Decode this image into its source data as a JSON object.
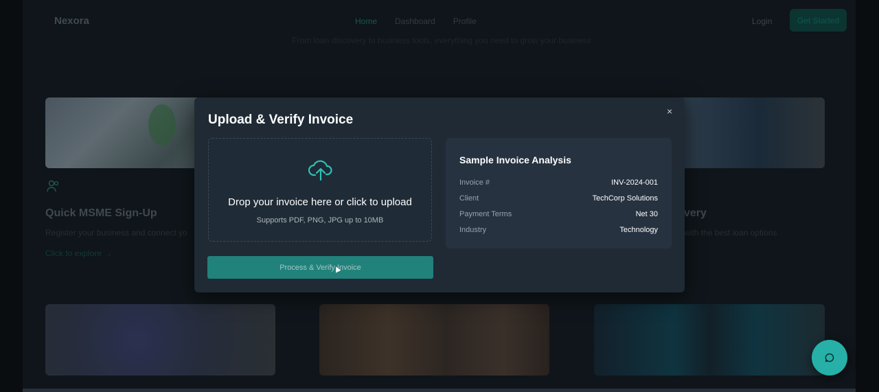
{
  "nav": {
    "logo": "Nexora",
    "links": [
      "Home",
      "Dashboard",
      "Profile"
    ],
    "active_link": "Home",
    "login_label": "Login",
    "cta_label": "Get Started"
  },
  "hero": {
    "subtitle": "From loan discovery to business tools, everything you need to grow your business"
  },
  "cards": {
    "card1": {
      "title": "Quick MSME Sign-Up",
      "description": "Register your business and connect yo",
      "link": "Click to explore →"
    },
    "card3": {
      "title_fragment": "very",
      "description_fragment": "with the best loan options"
    }
  },
  "modal": {
    "title": "Upload & Verify Invoice",
    "close_label": "×",
    "dropzone": {
      "icon": "cloud-upload-icon",
      "text": "Drop your invoice here or click to upload",
      "subtext": "Supports PDF, PNG, JPG up to 10MB"
    },
    "process_button": "Process & Verify Invoice",
    "analysis": {
      "title": "Sample Invoice Analysis",
      "rows": [
        {
          "label": "Invoice #",
          "value": "INV-2024-001"
        },
        {
          "label": "Client",
          "value": "TechCorp Solutions"
        },
        {
          "label": "Payment Terms",
          "value": "Net 30"
        },
        {
          "label": "Industry",
          "value": "Technology"
        }
      ]
    }
  },
  "chat": {
    "icon": "chat-icon"
  },
  "colors": {
    "accent": "#21827c",
    "chat": "#26b0a8",
    "modal_bg": "#1f2a34",
    "panel_bg": "#263240"
  }
}
